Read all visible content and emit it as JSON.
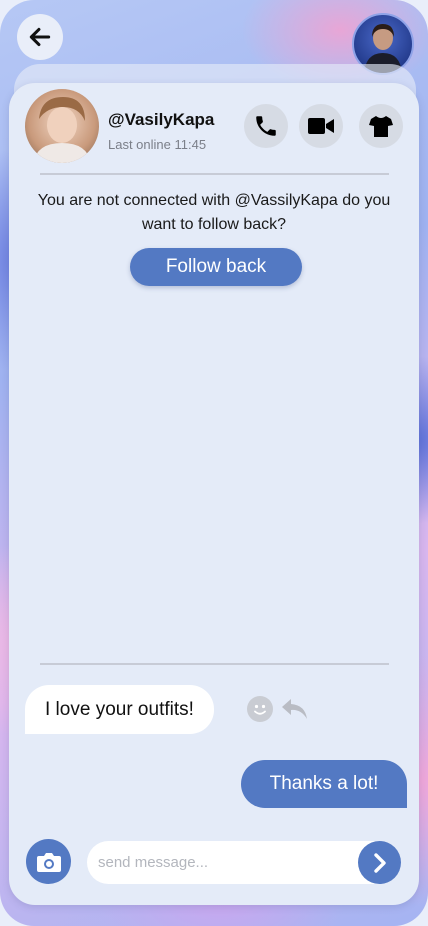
{
  "header": {
    "back_icon": "arrow-left-icon",
    "profile_avatar": "user-avatar"
  },
  "contact": {
    "username": "@VasilyKapa",
    "last_online": "Last online 11:45"
  },
  "actions": {
    "call_icon": "phone-icon",
    "video_icon": "video-camera-icon",
    "outfit_icon": "tshirt-icon"
  },
  "connection": {
    "notice": "You are not connected with @VassilyKapa do you want to follow back?",
    "follow_label": "Follow back"
  },
  "messages": [
    {
      "direction": "incoming",
      "text": "I love your outfits!"
    },
    {
      "direction": "outgoing",
      "text": "Thanks a lot!"
    }
  ],
  "composer": {
    "placeholder": "send message...",
    "camera_icon": "camera-icon",
    "send_icon": "chevron-right-icon"
  },
  "colors": {
    "accent": "#5379c3",
    "panel": "#e4ebf8",
    "icon_button_bg": "#d6dbe4"
  }
}
